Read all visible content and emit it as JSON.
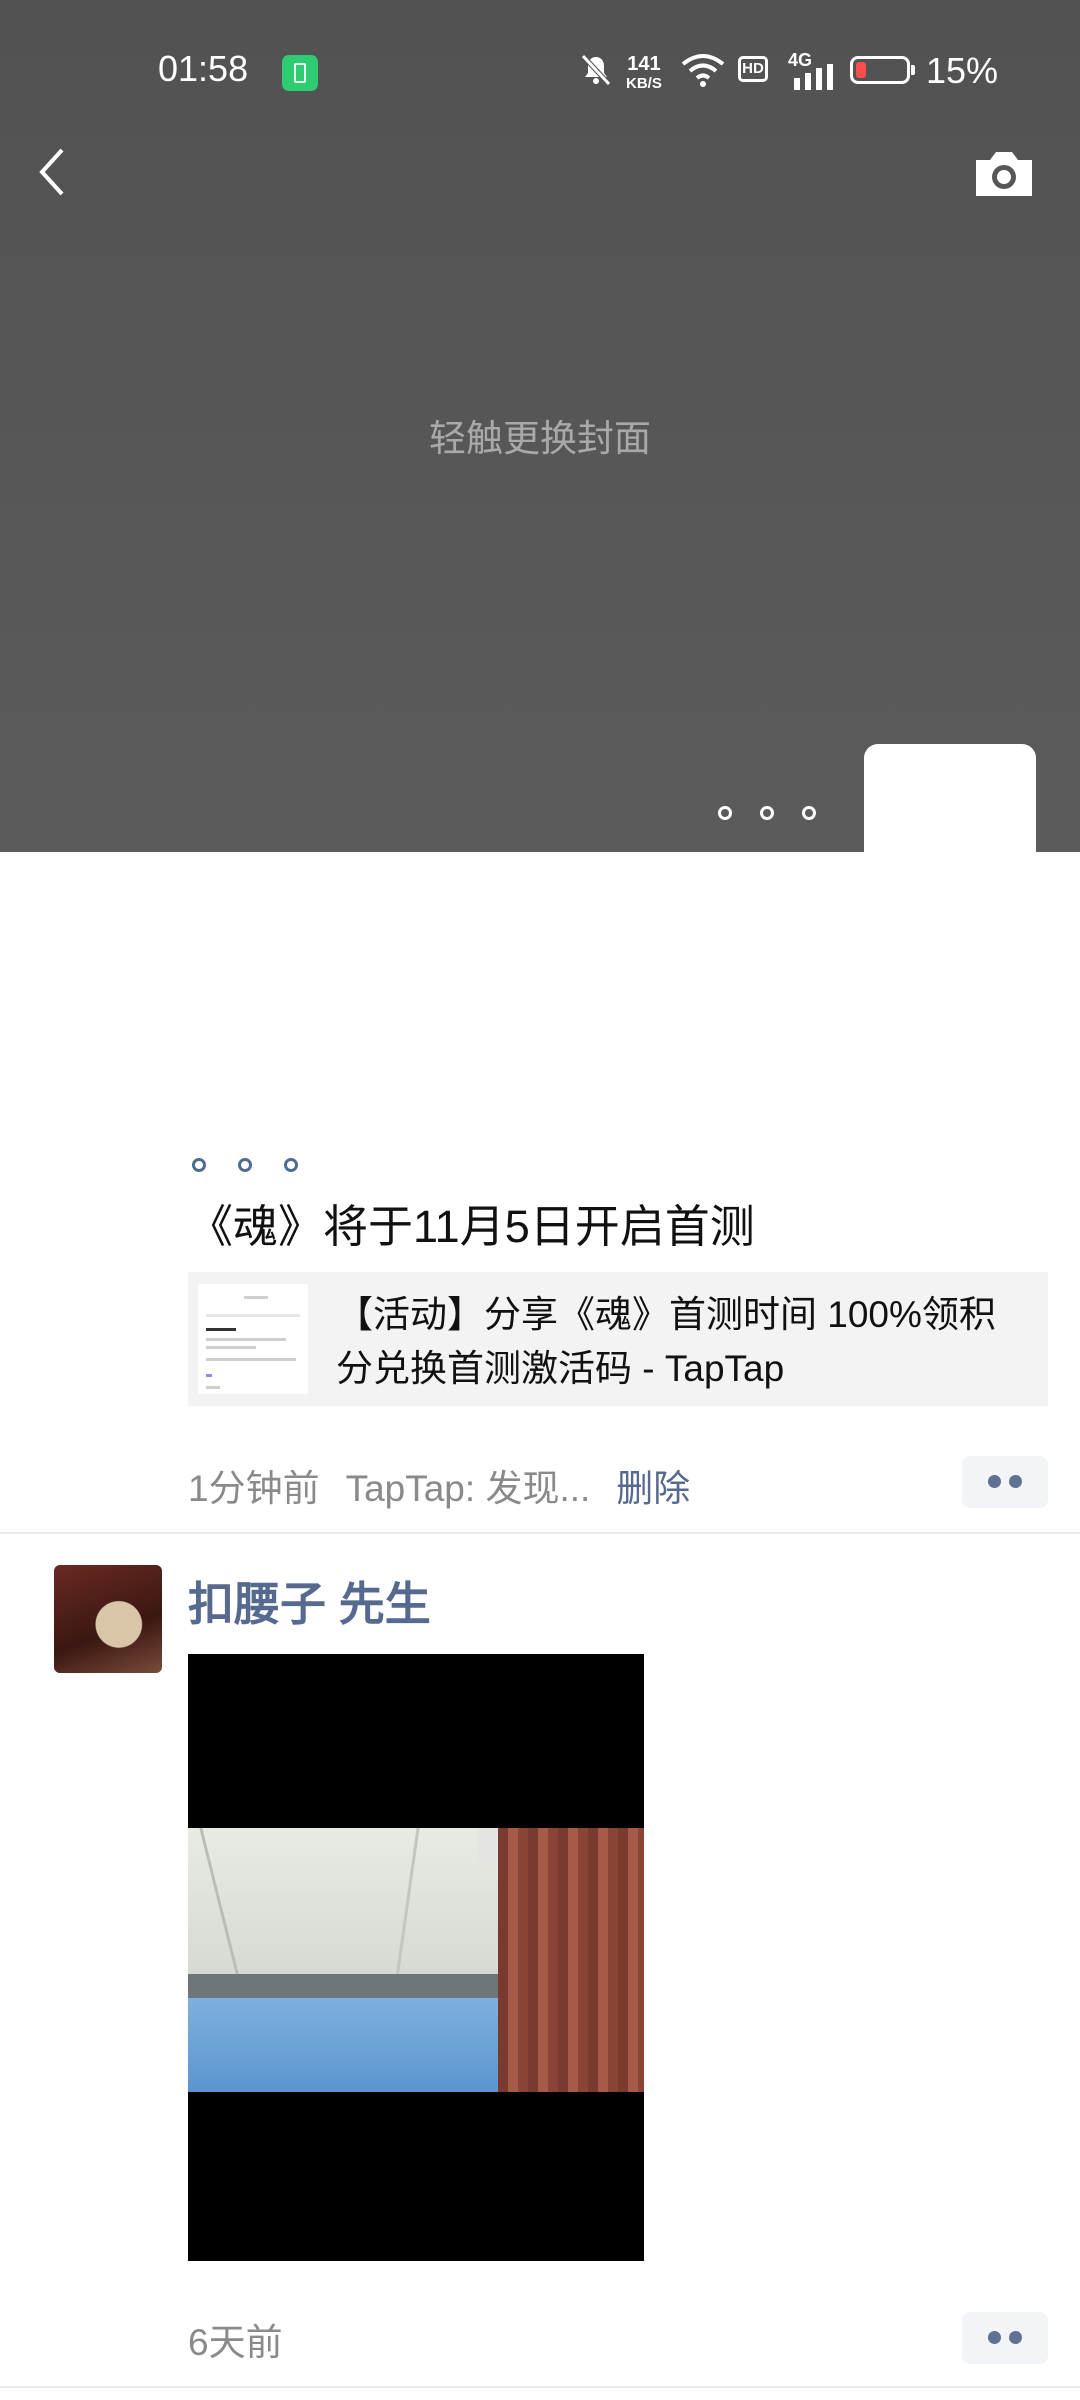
{
  "status_bar": {
    "time": "01:58",
    "net_speed_value": "141",
    "net_speed_unit": "KB/S",
    "hd_label": "HD",
    "network_label": "4G",
    "battery_percent": "15%"
  },
  "header": {
    "cover_hint": "轻触更换封面"
  },
  "posts": [
    {
      "text": "《魂》将于11月5日开启首测",
      "link_title": "【活动】分享《魂》首测时间 100%领积分兑换首测激活码 - TapTap",
      "time": "1分钟前",
      "source": "TapTap: 发现...",
      "delete_label": "删除"
    },
    {
      "username": "扣腰子 先生",
      "time": "6天前"
    }
  ],
  "colors": {
    "cover_bg": "#575757",
    "link_blue": "#56698f",
    "meta_gray": "#8a8a8a",
    "battery_low": "#ff4d4d",
    "battery_saver": "#2ecc71"
  }
}
